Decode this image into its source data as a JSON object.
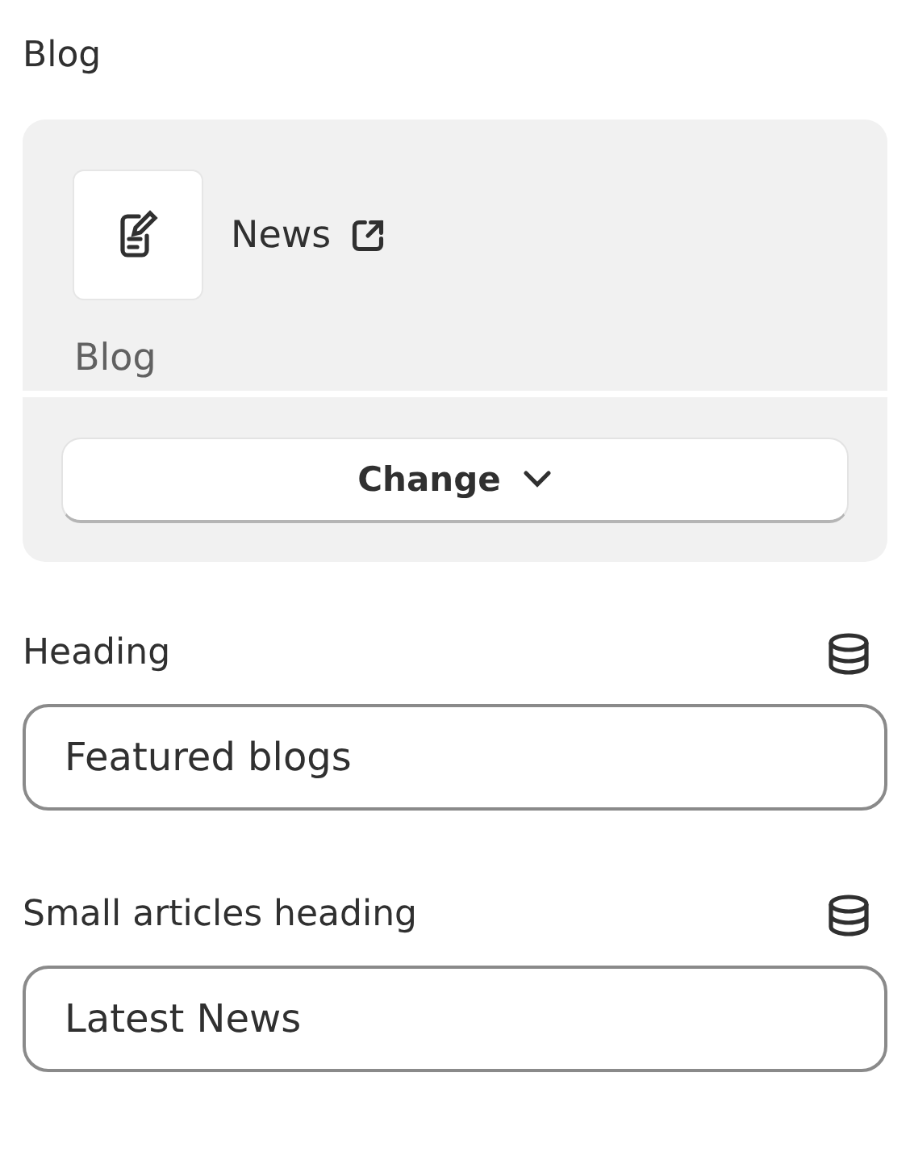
{
  "section_label": "Blog",
  "blog_card": {
    "title": "News",
    "subtitle": "Blog",
    "button": "Change"
  },
  "fields": [
    {
      "label": "Heading",
      "value": "Featured blogs"
    },
    {
      "label": "Small articles heading",
      "value": "Latest News"
    }
  ]
}
